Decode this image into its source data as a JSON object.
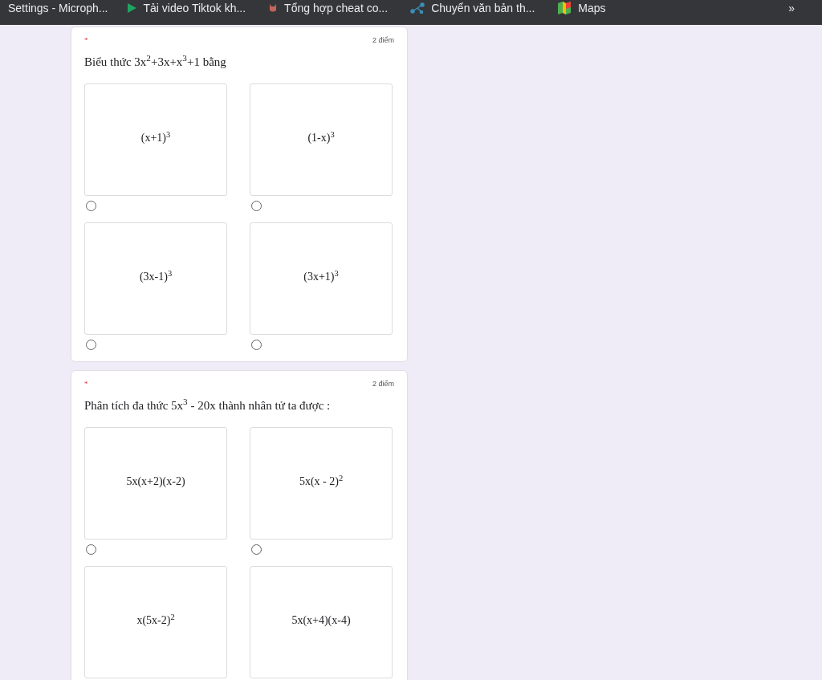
{
  "bookmarks": [
    {
      "label": "Settings - Microph...",
      "kind": "none"
    },
    {
      "label": "Tải video Tiktok kh...",
      "kind": "play"
    },
    {
      "label": "Tổng hợp cheat co...",
      "kind": "cat"
    },
    {
      "label": "Chuyển văn bản th...",
      "kind": "network"
    },
    {
      "label": "Maps",
      "kind": "map"
    }
  ],
  "more": "»",
  "questions": [
    {
      "required": "*",
      "points": "2 điểm",
      "text": "Biểu thức 3x$^{2}$+3x+x$^{3}$+1 bằng",
      "options": [
        {
          "label": "(x+1)$^{3}$",
          "selected": false
        },
        {
          "label": "(1-x)$^{3}$",
          "selected": false
        },
        {
          "label": "(3x-1)$^{3}$",
          "selected": false
        },
        {
          "label": "(3x+1)$^{3}$",
          "selected": false
        }
      ]
    },
    {
      "required": "*",
      "points": "2 điểm",
      "text": "Phân tích đa thức 5x$^{3}$ - 20x thành nhân tử ta được :",
      "options": [
        {
          "label": "5x(x+2)(x-2)",
          "selected": false
        },
        {
          "label": "5x(x - 2)$^{2}$",
          "selected": false
        },
        {
          "label": "x(5x-2)$^{2}$"
        },
        {
          "label": "5x(x+4)(x-4)"
        }
      ]
    }
  ]
}
